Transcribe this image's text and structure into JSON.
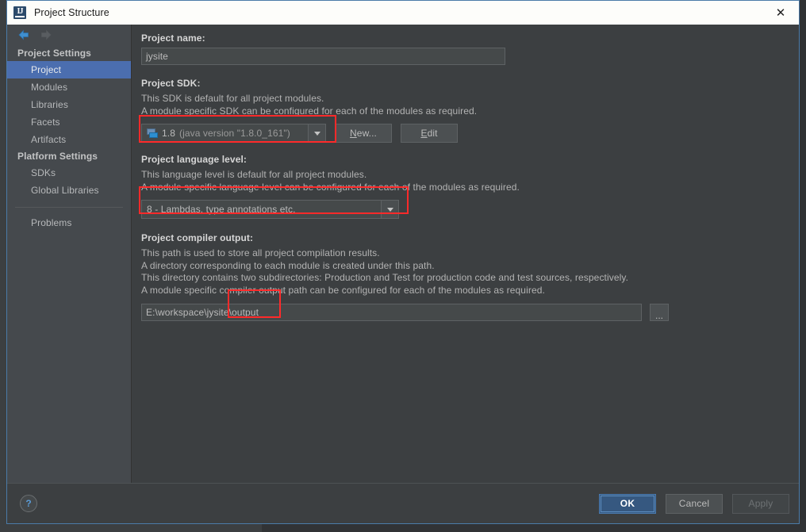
{
  "window": {
    "title": "Project Structure",
    "app_icon": "intellij-idea-icon",
    "close_label": "✕"
  },
  "nav": {
    "back_icon": "arrow-left-icon",
    "forward_icon": "arrow-right-icon"
  },
  "sidebar": {
    "groups": [
      {
        "label": "Project Settings",
        "items": [
          {
            "label": "Project",
            "selected": true
          },
          {
            "label": "Modules",
            "selected": false
          },
          {
            "label": "Libraries",
            "selected": false
          },
          {
            "label": "Facets",
            "selected": false
          },
          {
            "label": "Artifacts",
            "selected": false
          }
        ]
      },
      {
        "label": "Platform Settings",
        "items": [
          {
            "label": "SDKs",
            "selected": false
          },
          {
            "label": "Global Libraries",
            "selected": false
          }
        ]
      }
    ],
    "problems": {
      "label": "Problems"
    }
  },
  "main": {
    "project_name": {
      "label": "Project name:",
      "value": "jysite"
    },
    "project_sdk": {
      "label": "Project SDK:",
      "desc_line1": "This SDK is default for all project modules.",
      "desc_line2": "A module specific SDK can be configured for each of the modules as required.",
      "selected_version": "1.8",
      "selected_detail": "(java version \"1.8.0_161\")",
      "sdk_icon": "java-sdk-icon",
      "dropdown_icon": "chevron-down-icon",
      "new_button": "New...",
      "new_button_mnemonic": "N",
      "edit_button": "Edit",
      "edit_button_mnemonic": "E"
    },
    "language_level": {
      "label": "Project language level:",
      "desc_line1": "This language level is default for all project modules.",
      "desc_line2": "A module specific language level can be configured for each of the modules as required.",
      "selected": "8 - Lambdas, type annotations etc.",
      "dropdown_icon": "chevron-down-icon"
    },
    "compiler_output": {
      "label": "Project compiler output:",
      "desc_line1": "This path is used to store all project compilation results.",
      "desc_line2": "A directory corresponding to each module is created under this path.",
      "desc_line3": "This directory contains two subdirectories: Production and Test for production code and test sources, respectively.",
      "desc_line4": "A module specific compiler output path can be configured for each of the modules as required.",
      "path_value": "E:\\workspace\\jysite\\output",
      "browse_button": "...",
      "browse_icon": "ellipsis-icon"
    }
  },
  "footer": {
    "help_icon": "help-question-icon",
    "help_label": "?",
    "ok_label": "OK",
    "cancel_label": "Cancel",
    "apply_label": "Apply"
  },
  "annotations": {
    "highlight_color": "#ff2a2a",
    "boxes": [
      {
        "name": "sdk-combo-highlight"
      },
      {
        "name": "language-level-combo-highlight"
      },
      {
        "name": "output-path-highlight"
      }
    ]
  },
  "colors": {
    "accent": "#4b6eaf",
    "primary_button": "#365880",
    "panel_bg": "#3c3f41",
    "sidebar_bg": "#45494d",
    "field_bg": "#45494a",
    "window_border": "#4b7ba8"
  }
}
